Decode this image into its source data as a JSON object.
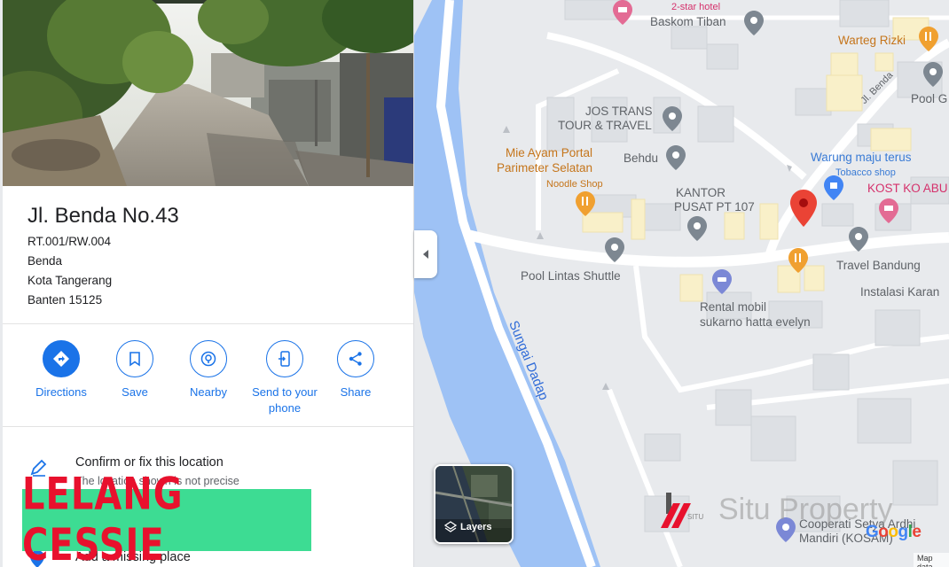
{
  "place": {
    "title": "Jl. Benda No.43",
    "address_lines": [
      "RT.001/RW.004",
      "Benda",
      "Kota Tangerang",
      "Banten 15125"
    ]
  },
  "actions": [
    {
      "label": "Directions",
      "icon": "directions-icon"
    },
    {
      "label": "Save",
      "icon": "bookmark-icon"
    },
    {
      "label": "Nearby",
      "icon": "nearby-icon"
    },
    {
      "label": "Send to your phone",
      "label_line1": "Send to your",
      "label_line2": "phone",
      "icon": "phone-icon"
    },
    {
      "label": "Share",
      "icon": "share-icon"
    }
  ],
  "confirm": {
    "title": "Confirm or fix this location",
    "subtitle": "The location shown is not precise"
  },
  "add_place": {
    "label": "Add a missing place"
  },
  "banner": {
    "text": "LELANG CESSIE",
    "bg_color": "#3ddc93",
    "text_color": "#e8112d"
  },
  "map": {
    "labels": {
      "hotel": "2-star hotel",
      "baskom": "Baskom Tiban",
      "warteg": "Warteg Rizki",
      "jl_benda": "Jl. Benda",
      "pool_g": "Pool G",
      "jos_trans_1": "JOS TRANS",
      "jos_trans_2": "TOUR & TRAVEL",
      "mie_ayam_1": "Mie Ayam Portal",
      "mie_ayam_2": "Parimeter Selatan",
      "noodle": "Noodle Shop",
      "behdu": "Behdu",
      "warung": "Warung maju terus",
      "tobacco": "Tobacco shop",
      "kantor_1": "KANTOR",
      "kantor_2": "PUSAT PT 107",
      "kost": "KOST KO ABU",
      "travel": "Travel Bandung",
      "pool_lintas": "Pool Lintas Shuttle",
      "instalasi": "Instalasi Karan",
      "rental_1": "Rental mobil",
      "rental_2": "sukarno hatta evelyn",
      "sungai": "Sungai Dadap",
      "koperasi_1": "Cooperati Setya Ardhi",
      "koperasi_2": "Mandiri (KOSAM)"
    },
    "layers_label": "Layers",
    "google": "Google",
    "map_data": "Map data",
    "watermark": "Situ Property",
    "watermark_logo": "SITU"
  },
  "colors": {
    "accent": "#1a73e8",
    "water": "#9ec2f5",
    "pin_red": "#ea4335"
  }
}
